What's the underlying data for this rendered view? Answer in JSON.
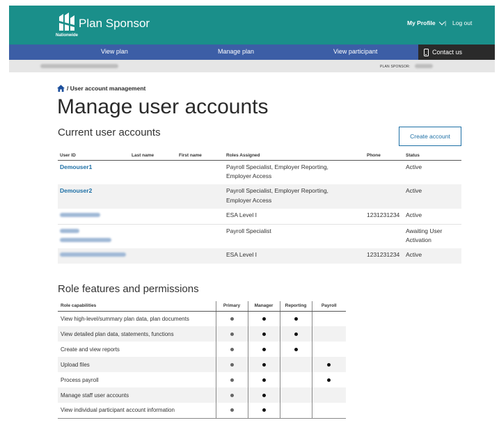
{
  "header": {
    "logo_text": "Nationwide",
    "app_title": "Plan Sponsor",
    "my_profile": "My Profile",
    "separator": "|",
    "logout": "Log out"
  },
  "nav": {
    "items": [
      "View plan",
      "Manage plan",
      "View participant"
    ],
    "contact": "Contact us"
  },
  "subbar": {
    "plan_sponsor_label": "PLAN SPONSOR:"
  },
  "breadcrumb": "/ User account management",
  "page_title": "Manage user accounts",
  "current": {
    "title": "Current user accounts",
    "create_button": "Create account",
    "headers": {
      "user_id": "User ID",
      "last_name": "Last name",
      "first_name": "First name",
      "roles": "Roles Assigned",
      "phone": "Phone",
      "status": "Status"
    },
    "rows": [
      {
        "user_id": "Demouser1",
        "roles_line1": "Payroll Specialist, Employer Reporting,",
        "roles_line2": "Employer Access",
        "phone": "",
        "status_line1": "Active",
        "status_line2": ""
      },
      {
        "user_id": "Demouser2",
        "roles_line1": "Payroll Specialist, Employer Reporting,",
        "roles_line2": "Employer Access",
        "phone": "",
        "status_line1": "Active",
        "status_line2": ""
      },
      {
        "user_id": "",
        "roles_line1": "ESA Level I",
        "roles_line2": "",
        "phone": "1231231234",
        "status_line1": "Active",
        "status_line2": ""
      },
      {
        "user_id": "",
        "roles_line1": "Payroll Specialist",
        "roles_line2": "",
        "phone": "",
        "status_line1": "Awaiting User",
        "status_line2": "Activation"
      },
      {
        "user_id": "",
        "roles_line1": "ESA Level I",
        "roles_line2": "",
        "phone": "1231231234",
        "status_line1": "Active",
        "status_line2": ""
      }
    ]
  },
  "roles": {
    "title": "Role features and permissions",
    "headers": {
      "capabilities": "Role capabilities",
      "primary": "Primary",
      "manager": "Manager",
      "reporting": "Reporting",
      "payroll": "Payroll"
    },
    "rows": [
      {
        "label": "View high-level/summary plan data, plan documents"
      },
      {
        "label": "View detailed plan data, statements, functions"
      },
      {
        "label": "Create and view reports"
      },
      {
        "label": "Upload files"
      },
      {
        "label": "Process payroll"
      },
      {
        "label": "Manage staff user accounts"
      },
      {
        "label": "View individual participant account information"
      }
    ]
  },
  "permissions": [
    {
      "primary": true,
      "manager": true,
      "reporting": true,
      "payroll": false
    },
    {
      "primary": true,
      "manager": true,
      "reporting": true,
      "payroll": false
    },
    {
      "primary": true,
      "manager": true,
      "reporting": true,
      "payroll": false
    },
    {
      "primary": true,
      "manager": true,
      "reporting": false,
      "payroll": true
    },
    {
      "primary": true,
      "manager": true,
      "reporting": false,
      "payroll": true
    },
    {
      "primary": true,
      "manager": true,
      "reporting": false,
      "payroll": false
    },
    {
      "primary": true,
      "manager": true,
      "reporting": false,
      "payroll": false
    }
  ],
  "colors": {
    "header_teal": "#1a8f8a",
    "nav_blue": "#3c5ea6",
    "contact_dark": "#2a2a2a",
    "link_blue": "#1d6fa5"
  }
}
